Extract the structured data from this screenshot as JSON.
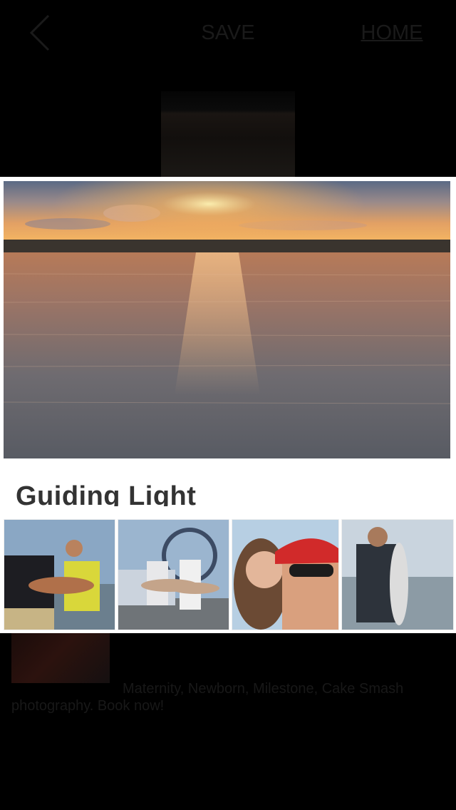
{
  "nav": {
    "back_icon": "chevron-left-icon",
    "save_label": "SAVE",
    "home_label": "HOME"
  },
  "card": {
    "title": "Guiding Light"
  },
  "thumbnails": [
    {
      "subject": "angler-with-redfish-on-boat"
    },
    {
      "subject": "two-anglers-with-fish-by-airboat"
    },
    {
      "subject": "couple-selfie"
    },
    {
      "subject": "angler-holding-large-fish"
    }
  ],
  "background_listing": {
    "heading": "",
    "description": "Maternity, Newborn, Milestone, Cake Smash photography. Book now!"
  },
  "colors": {
    "page_background": "#000000",
    "panel_background": "#ffffff",
    "text_dark": "#1a1a1a"
  }
}
